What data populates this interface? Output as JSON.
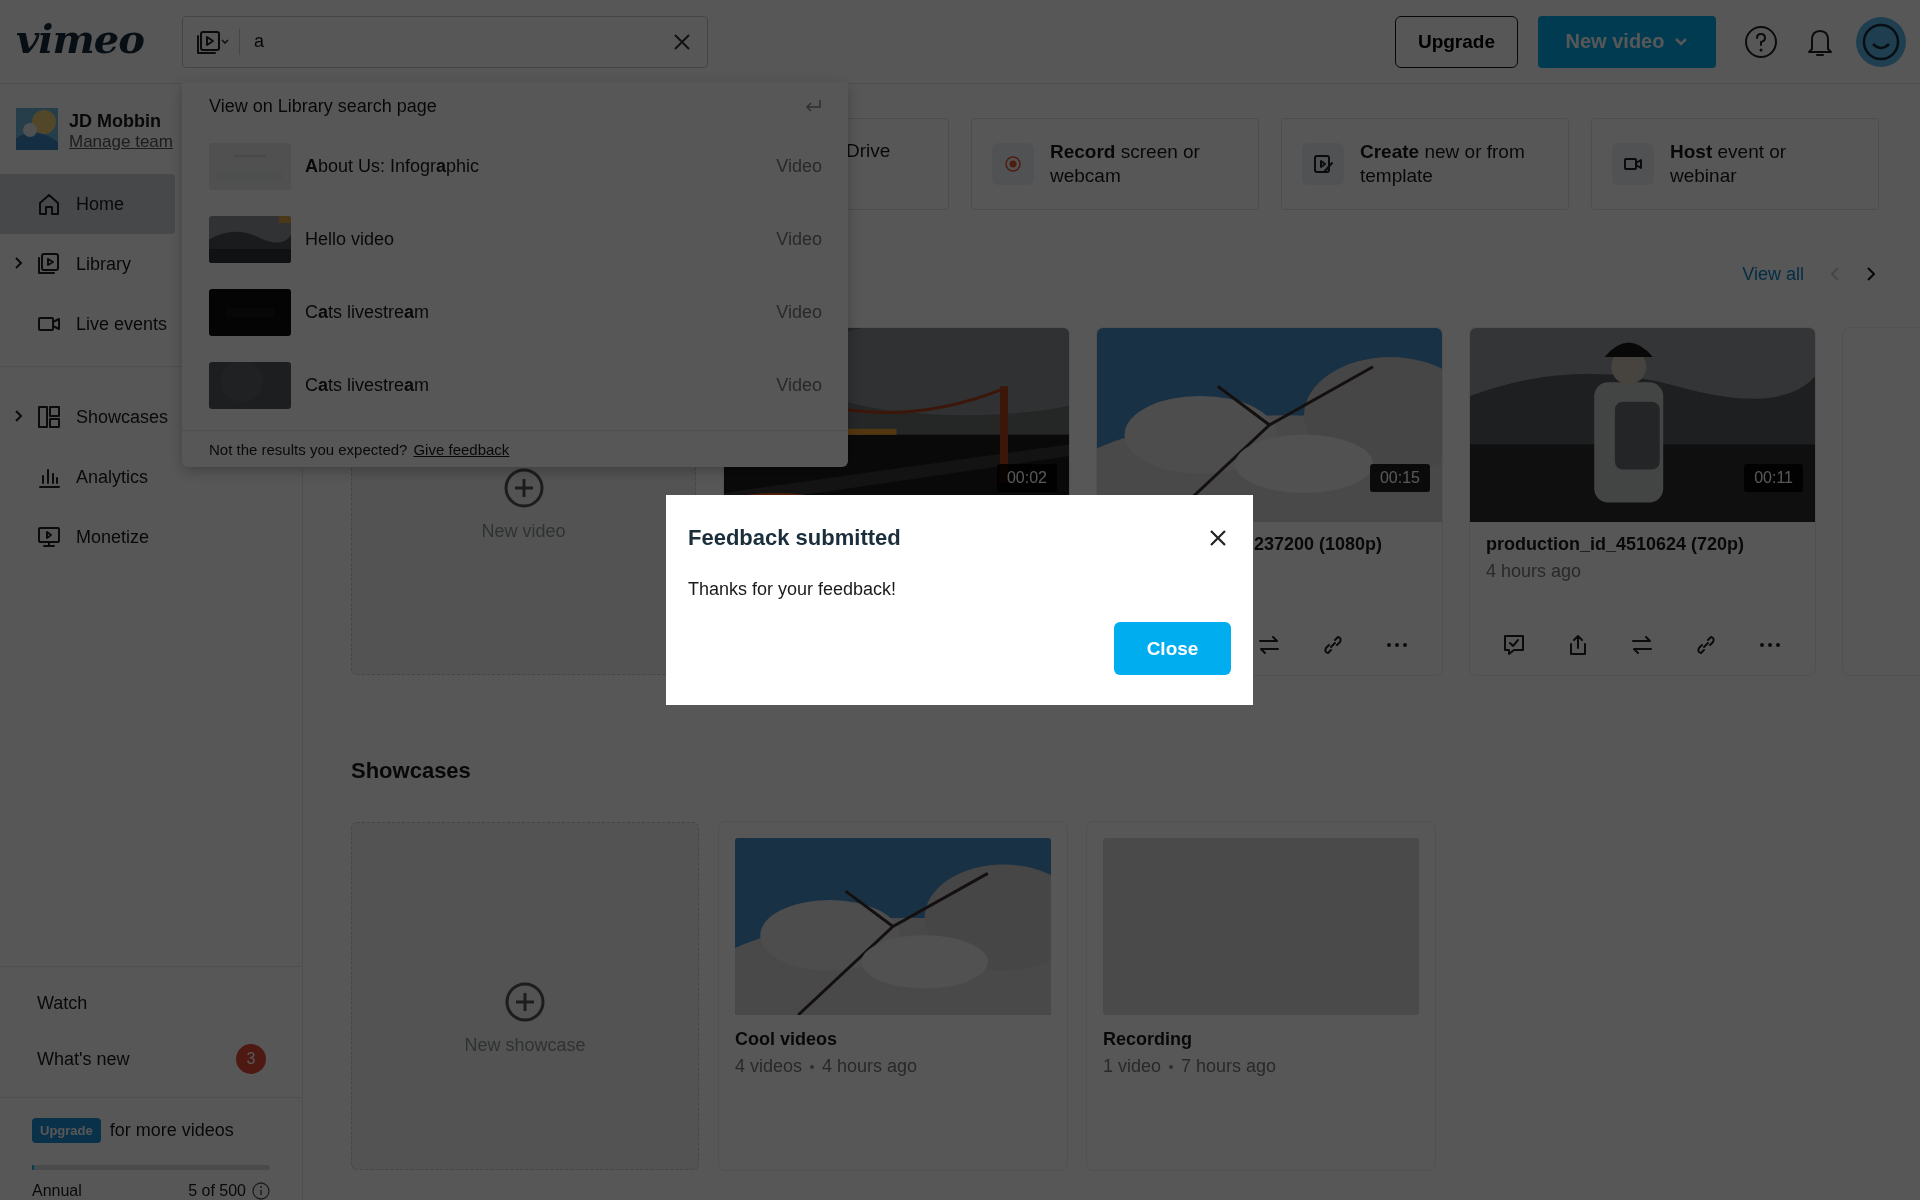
{
  "topbar": {
    "logo": "vimeo",
    "search": {
      "value": "a"
    },
    "buttons": [
      {
        "label": "Upgrade",
        "kind": "outline"
      },
      {
        "label": "New video",
        "kind": "primary"
      }
    ]
  },
  "search_dropdown": {
    "header": "View on Library search page",
    "results": [
      {
        "title": "**A**bout Us: Infogr**a**phic",
        "type": "Video"
      },
      {
        "title": "Hello video",
        "type": "Video"
      },
      {
        "title": "C**a**ts livestre**a**m",
        "type": "Video"
      },
      {
        "title": "C**a**ts livestre**a**m",
        "type": "Video"
      }
    ],
    "footer_text": "Not the results you expected?",
    "footer_link": "Give feedback"
  },
  "sidebar": {
    "profile": {
      "name": "JD Mobbin",
      "link": "Manage team"
    },
    "items": [
      {
        "label": "Home",
        "selected": true,
        "expandable": false
      },
      {
        "label": "Library",
        "selected": false,
        "expandable": true
      },
      {
        "label": "Live events",
        "selected": false,
        "expandable": false
      },
      {
        "label": "Showcases",
        "selected": false,
        "expandable": true
      },
      {
        "label": "Analytics",
        "selected": false,
        "expandable": false
      },
      {
        "label": "Monetize",
        "selected": false,
        "expandable": false
      }
    ],
    "bottom_items": [
      {
        "label": "Watch"
      },
      {
        "label": "What's new",
        "badge": "3"
      }
    ],
    "plan": {
      "badge": "Upgrade",
      "text": "for more videos",
      "level": 0.01,
      "name": "Annual",
      "usage": "5 of 500"
    }
  },
  "quick_actions": [
    {
      "kind": "partial",
      "text": "Drive"
    },
    {
      "kind": "full",
      "text": "**Record** screen or webcam"
    },
    {
      "kind": "full",
      "text": "**Create** new or from template"
    },
    {
      "kind": "full",
      "text": "**Host** event or webinar"
    }
  ],
  "videos": {
    "view_all": "View all",
    "cards": [
      {
        "kind": "new",
        "label": "New video"
      },
      {
        "kind": "covered",
        "duration": "00:02"
      },
      {
        "kind": "partial",
        "duration": "00:15",
        "title": "237200 (1080p)"
      },
      {
        "kind": "video",
        "duration": "00:11",
        "title": "production_id_4510624 (720p)",
        "meta": "4 hours ago"
      },
      {
        "kind": "edge"
      }
    ]
  },
  "showcases": {
    "title": "Showcases",
    "cards": [
      {
        "kind": "new",
        "label": "New showcase"
      },
      {
        "kind": "showcase",
        "title": "Cool videos",
        "count": "4 videos",
        "time": "4 hours ago"
      },
      {
        "kind": "showcase",
        "title": "Recording",
        "count": "1 video",
        "time": "7 hours ago"
      }
    ]
  },
  "modal": {
    "title": "Feedback submitted",
    "message": "Thanks for your feedback!",
    "button": "Close"
  }
}
